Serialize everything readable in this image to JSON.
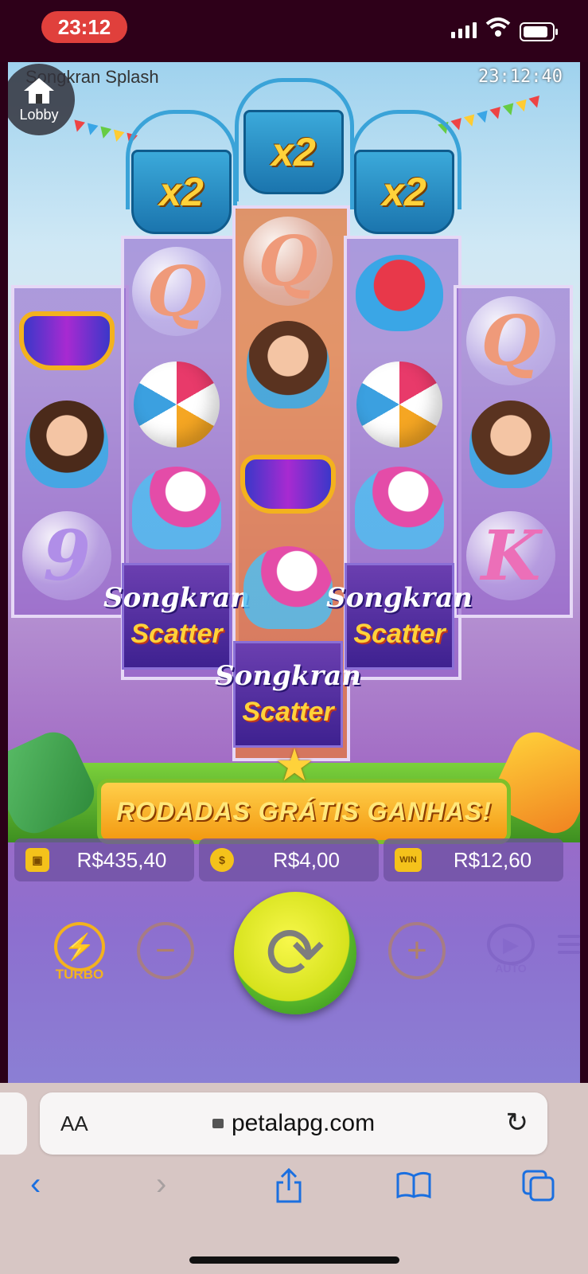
{
  "status_bar": {
    "time": "23:12"
  },
  "game": {
    "title": "Songkran Splash",
    "clock": "23:12:40",
    "lobby_label": "Lobby",
    "multipliers": [
      "x2",
      "x2",
      "x2"
    ],
    "grid": {
      "col1": [
        "glasses",
        "man-with-water-gun",
        "bubble-9"
      ],
      "col2": [
        "bubble-Q",
        "beach-ball",
        "unicorn-float",
        "scatter"
      ],
      "col3": [
        "bubble-Q",
        "girl-winking",
        "glasses",
        "unicorn-float",
        "scatter"
      ],
      "col4": [
        "water-bowl",
        "beach-ball",
        "unicorn-float",
        "scatter"
      ],
      "col5": [
        "bubble-Q",
        "girl-winking",
        "bubble-K"
      ]
    },
    "symbol_text": {
      "q": "Q",
      "k": "K",
      "nine": "9",
      "scatter_top": "Songkran",
      "scatter_bottom": "Scatter"
    },
    "banner": "RODADAS GRÁTIS GANHAS!",
    "balance": "R$435,40",
    "bet": "R$4,00",
    "win": "R$12,60",
    "win_icon": "WIN",
    "turbo_label": "TURBO",
    "auto_label": "AUTO"
  },
  "browser": {
    "aa_label": "AA",
    "url": "petalapg.com"
  },
  "colors": {
    "accent_gold": "#f3b21e",
    "spin_green": "#56b52a",
    "safari_blue": "#1a6fe0"
  }
}
